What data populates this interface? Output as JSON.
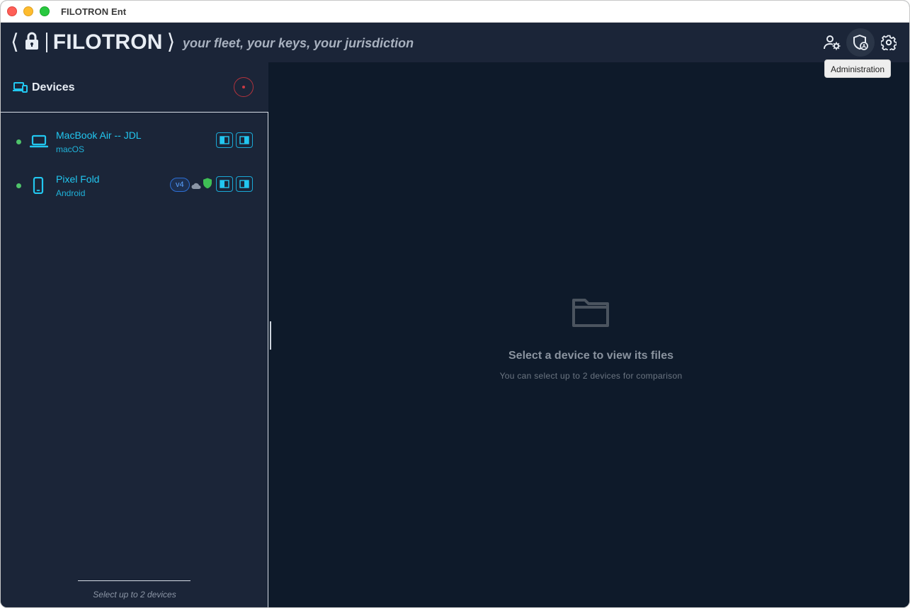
{
  "window": {
    "title": "FILOTRON Ent"
  },
  "header": {
    "brand_name": "FILOTRON",
    "tagline": "your fleet, your keys, your jurisdiction",
    "icons": [
      "user-settings-icon",
      "shield-admin-icon",
      "gear-icon"
    ],
    "tooltip": "Administration"
  },
  "sidebar": {
    "title": "Devices",
    "devices": [
      {
        "name": "MacBook Air -- JDL",
        "os": "macOS",
        "status": "online",
        "icon": "laptop-icon"
      },
      {
        "name": "Pixel Fold",
        "os": "Android",
        "status": "online",
        "icon": "phone-icon",
        "badge": "v4"
      }
    ],
    "footer": "Select up to 2 devices"
  },
  "main": {
    "empty_title": "Select a device to view its files",
    "empty_subtitle": "You can select up to 2 devices for comparison"
  },
  "colors": {
    "accent": "#22c7f0",
    "online": "#4fc36a",
    "shield": "#3fbf55",
    "record": "#c93a44"
  }
}
